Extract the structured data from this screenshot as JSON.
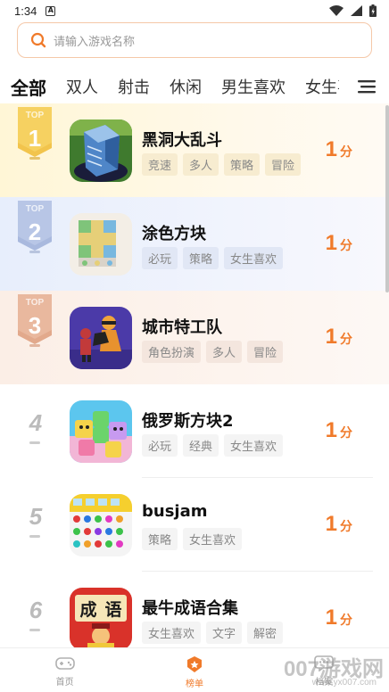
{
  "statusbar": {
    "time": "1:34"
  },
  "search": {
    "placeholder": "请输入游戏名称"
  },
  "tabs": [
    {
      "label": "全部",
      "active": true
    },
    {
      "label": "双人"
    },
    {
      "label": "射击"
    },
    {
      "label": "休闲"
    },
    {
      "label": "男生喜欢"
    },
    {
      "label": "女生喜欢"
    }
  ],
  "games": [
    {
      "rank": "1",
      "top_label": "TOP",
      "title": "黑洞大乱斗",
      "tags": [
        "竞速",
        "多人",
        "策略",
        "冒险"
      ],
      "score": "1",
      "unit": "分"
    },
    {
      "rank": "2",
      "top_label": "TOP",
      "title": "涂色方块",
      "tags": [
        "必玩",
        "策略",
        "女生喜欢"
      ],
      "score": "1",
      "unit": "分"
    },
    {
      "rank": "3",
      "top_label": "TOP",
      "title": "城市特工队",
      "tags": [
        "角色扮演",
        "多人",
        "冒险"
      ],
      "score": "1",
      "unit": "分"
    },
    {
      "rank": "4",
      "title": "俄罗斯方块2",
      "tags": [
        "必玩",
        "经典",
        "女生喜欢"
      ],
      "score": "1",
      "unit": "分"
    },
    {
      "rank": "5",
      "title": "busjam",
      "tags": [
        "策略",
        "女生喜欢"
      ],
      "score": "1",
      "unit": "分"
    },
    {
      "rank": "6",
      "title": "最牛成语合集",
      "tags": [
        "女生喜欢",
        "文字",
        "解密"
      ],
      "score": "1",
      "unit": "分",
      "icon_text": [
        "成",
        "语"
      ]
    }
  ],
  "bottomnav": [
    {
      "label": "首页",
      "icon": "gamepad-icon"
    },
    {
      "label": "榜单",
      "icon": "trophy-icon",
      "active": true
    },
    {
      "label": "档案",
      "icon": "chat-icon"
    }
  ],
  "watermark": {
    "main": "007游戏网",
    "sub": "www.yx007.com"
  },
  "colors": {
    "accent": "#f07a2a",
    "gold": "#f2c44c",
    "silver": "#a9b9de",
    "bronze": "#e2a98c"
  }
}
